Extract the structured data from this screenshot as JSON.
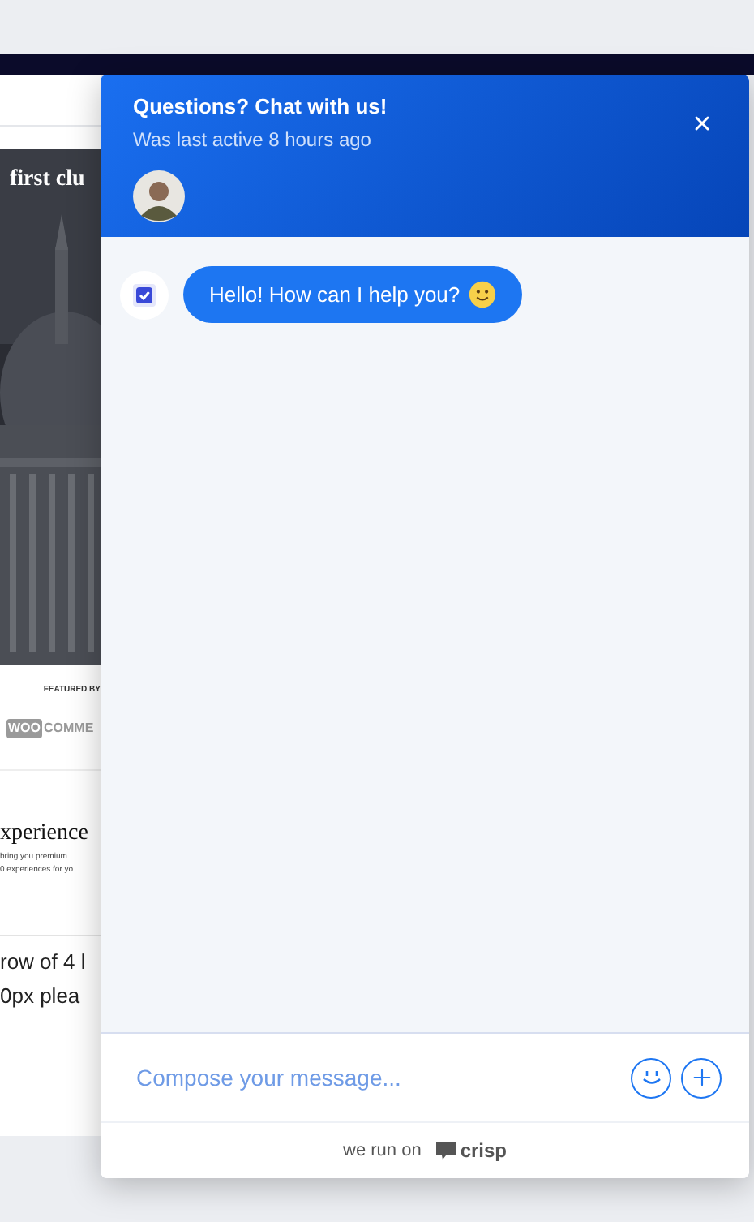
{
  "background_page": {
    "heading": "first clu",
    "featured": "FEATURED BY",
    "logo_mark": "WOO",
    "logo_word": "COMME",
    "headline": "xperience",
    "lines": [
      "bring you premium",
      "0 experiences for yo"
    ],
    "footer_lines": [
      "row of 4 l",
      "0px plea"
    ]
  },
  "chat": {
    "title": "Questions? Chat with us!",
    "subtitle": "Was last active 8 hours ago",
    "messages": [
      {
        "text": "Hello! How can I help you?"
      }
    ],
    "composer": {
      "placeholder": "Compose your message..."
    },
    "footer": {
      "prefix": "we run on",
      "brand": "crisp"
    }
  }
}
